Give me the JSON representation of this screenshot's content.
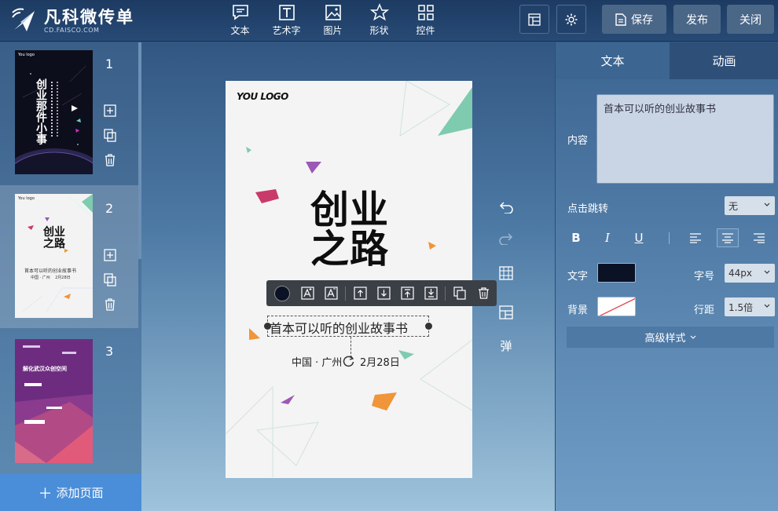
{
  "brand": {
    "title": "凡科微传单",
    "subtitle": "CD.FAISCO.COM"
  },
  "toolbar": {
    "tools": [
      {
        "label": "文本",
        "icon": "chat-bubble-icon"
      },
      {
        "label": "艺术字",
        "icon": "art-text-icon"
      },
      {
        "label": "图片",
        "icon": "image-icon"
      },
      {
        "label": "形状",
        "icon": "star-icon"
      },
      {
        "label": "控件",
        "icon": "grid-icon"
      }
    ],
    "save_label": "保存",
    "publish_label": "发布",
    "close_label": "关闭"
  },
  "pages": {
    "items": [
      {
        "number": "1",
        "thumb_title": "创业那件小事",
        "logo": "You logo"
      },
      {
        "number": "2",
        "thumb_title": "创业之路",
        "thumb_sub": "首本可以听的创业故事书",
        "thumb_meta": "中国 · 广州    2月28日",
        "logo": "You logo"
      },
      {
        "number": "3",
        "thumb_title": "解化武汉众创空间"
      }
    ],
    "add_label": "添加页面"
  },
  "canvas": {
    "logo": "YOU LOGO",
    "headline_line1": "创业",
    "headline_line2": "之路",
    "subtitle": "首本可以听的创业故事书",
    "location": "中国 · 广州",
    "date": "2月28日"
  },
  "side_tools": {
    "pop_label": "弹"
  },
  "panel": {
    "tab_text": "文本",
    "tab_anim": "动画",
    "content_label": "内容",
    "content_value": "首本可以听的创业故事书",
    "jump_label": "点击跳转",
    "jump_value": "无",
    "format": {
      "bold": "B",
      "italic": "I",
      "underline": "U"
    },
    "text_color_label": "文字",
    "text_color": "#0b1226",
    "font_size_label": "字号",
    "font_size_value": "44px",
    "bg_label": "背景",
    "line_height_label": "行距",
    "line_height_value": "1.5倍",
    "advanced_label": "高级样式"
  },
  "colors": {
    "accent": "#4a8ed9",
    "topbar": "#1d3b62",
    "teal": "#7fcbb0",
    "magenta": "#c83a6a",
    "orange": "#f0953a",
    "purple": "#9b58b5"
  }
}
